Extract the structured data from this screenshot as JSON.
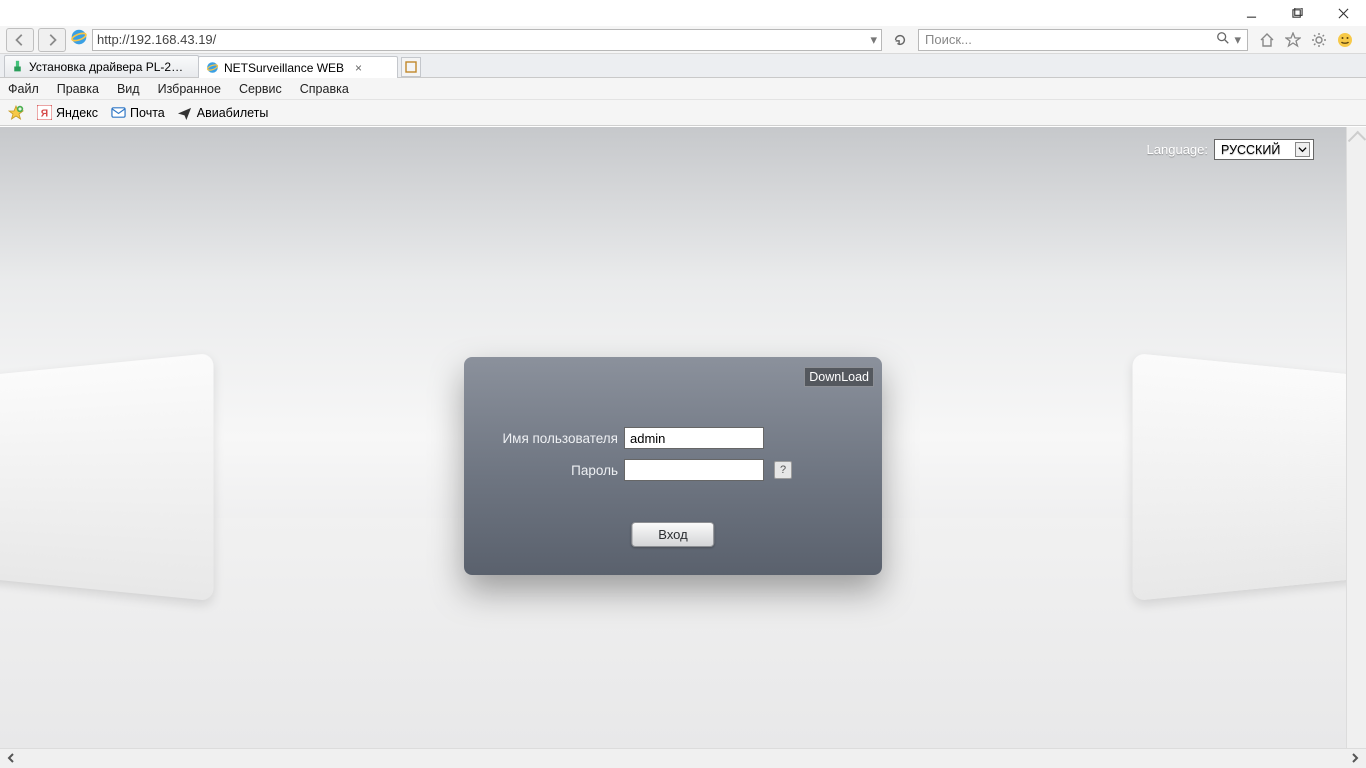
{
  "window": {
    "minimize": "—",
    "maximize": "❐",
    "close": "✕"
  },
  "address_bar": {
    "url": "http://192.168.43.19/"
  },
  "search": {
    "placeholder": "Поиск..."
  },
  "tabs": [
    {
      "title": "Установка драйвера PL-2303...",
      "active": false
    },
    {
      "title": "NETSurveillance WEB",
      "active": true
    }
  ],
  "menu": {
    "file": "Файл",
    "edit": "Правка",
    "view": "Вид",
    "fav": "Избранное",
    "service": "Сервис",
    "help": "Справка"
  },
  "favbar": [
    {
      "label": "Яндекс",
      "icon": "yandex-icon"
    },
    {
      "label": "Почта",
      "icon": "mail-icon"
    },
    {
      "label": "Авиабилеты",
      "icon": "plane-icon"
    }
  ],
  "page": {
    "language_label": "Language:",
    "language_value": "РУССКИЙ",
    "download_label": "DownLoad",
    "username_label": "Имя пользователя",
    "username_value": "admin",
    "password_label": "Пароль",
    "password_value": "",
    "help_label": "?",
    "login_label": "Вход"
  }
}
